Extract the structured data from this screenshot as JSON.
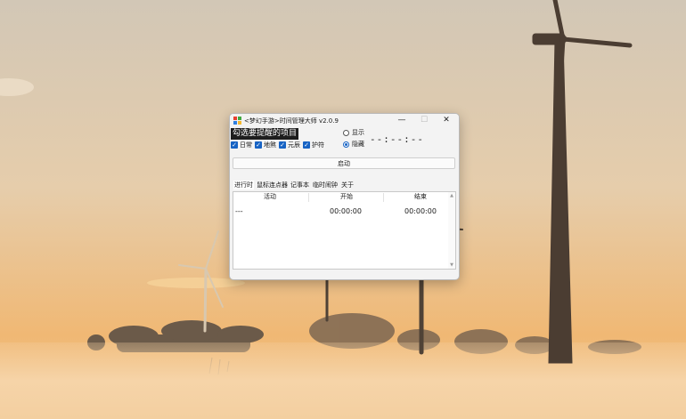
{
  "window": {
    "title": "<梦幻手游>时间管理大师 v2.0.9",
    "controls": {
      "minimize": "—",
      "maximize": "☐",
      "close": "✕"
    },
    "icon_colors": [
      "#e8402f",
      "#41a840",
      "#2f7fe0",
      "#f5b82e"
    ]
  },
  "hint_label": "勾选要提醒的项目",
  "display_mode": {
    "options": [
      {
        "label": "显示",
        "selected": false
      },
      {
        "label": "隐藏",
        "selected": true
      }
    ]
  },
  "clock_display": "--:--:--",
  "reminders": [
    {
      "label": "日常",
      "checked": true
    },
    {
      "label": "地煞",
      "checked": true
    },
    {
      "label": "元辰",
      "checked": true
    },
    {
      "label": "护符",
      "checked": true
    }
  ],
  "start_button": "启动",
  "tabs": [
    {
      "label": "进行时",
      "active": true
    },
    {
      "label": "鼠标连点器",
      "active": false
    },
    {
      "label": "记事本",
      "active": false
    },
    {
      "label": "临时闹钟",
      "active": false
    },
    {
      "label": "关于",
      "active": false
    }
  ],
  "table": {
    "columns": [
      "活动",
      "开始",
      "结束"
    ],
    "rows": [
      [
        "---",
        "00:00:00",
        "00:00:00"
      ]
    ]
  },
  "scroll_arrows": {
    "up": "▲",
    "down": "▼"
  },
  "colors": {
    "accent": "#1763c4",
    "sky_top": "#d3c6b2",
    "sky_bottom": "#f1b873",
    "fog": "#f6d7ac"
  }
}
